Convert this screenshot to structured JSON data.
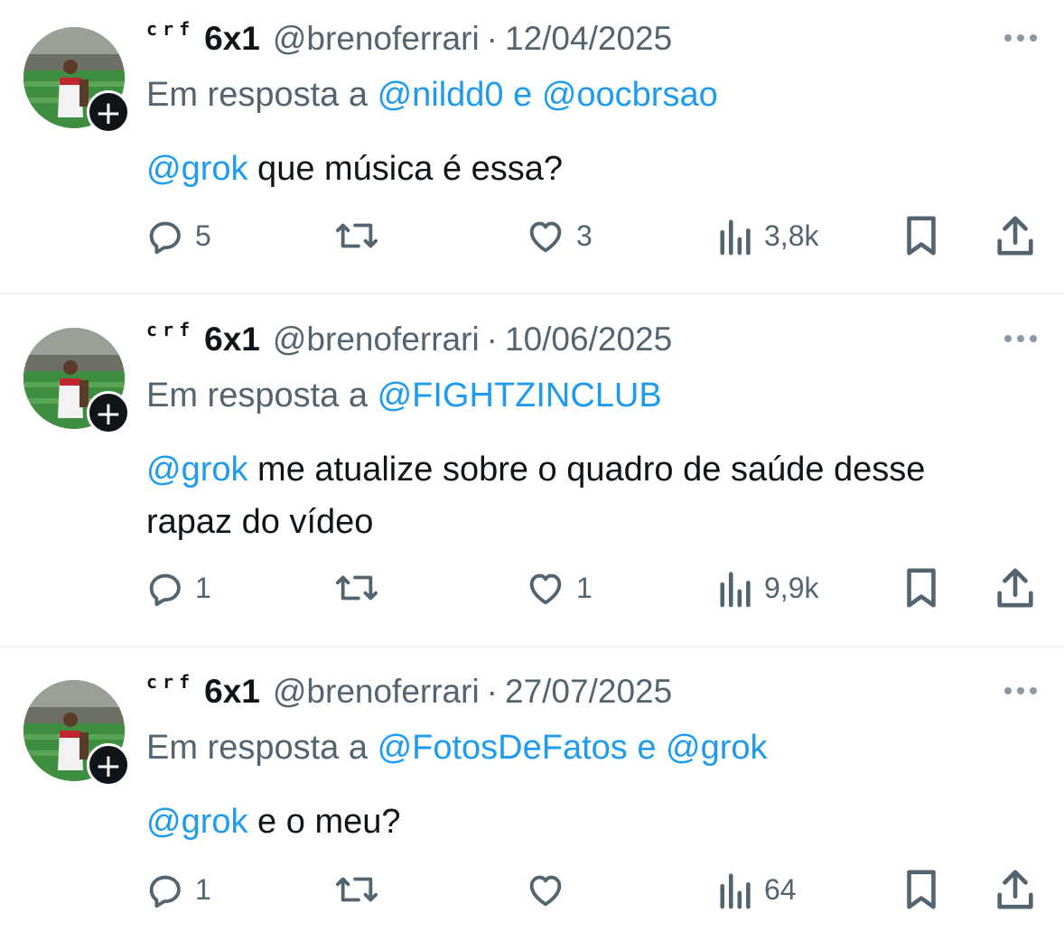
{
  "tweets": [
    {
      "author": {
        "prefix": "crf",
        "name": "6x1",
        "handle": "@breno​ferrari"
      },
      "date": "12/04/2025",
      "reply_label": "Em resposta a ",
      "reply_mentions": [
        "@nildd0",
        "@oocbrsao"
      ],
      "reply_joiner": " e ",
      "text_mention": "@grok",
      "text": " que música é essa?",
      "stats": {
        "replies": "5",
        "retweets": "",
        "likes": "3",
        "views": "3,8k"
      }
    },
    {
      "author": {
        "prefix": "crf",
        "name": "6x1",
        "handle": "@brenoferrari"
      },
      "date": "10/06/2025",
      "reply_label": "Em resposta a ",
      "reply_mentions": [
        "@FIGHTZINCLUB"
      ],
      "reply_joiner": "",
      "text_mention": "@grok",
      "text": " me atualize sobre o quadro de saúde desse rapaz do vídeo",
      "stats": {
        "replies": "1",
        "retweets": "",
        "likes": "1",
        "views": "9,9k"
      }
    },
    {
      "author": {
        "prefix": "crf",
        "name": "6x1",
        "handle": "@brenoferrari"
      },
      "date": "27/07/2025",
      "reply_label": "Em resposta a ",
      "reply_mentions": [
        "@FotosDeFatos",
        "@grok"
      ],
      "reply_joiner": " e ",
      "text_mention": "@grok",
      "text": " e o meu?",
      "stats": {
        "replies": "1",
        "retweets": "",
        "likes": "",
        "views": "64"
      }
    }
  ],
  "icons": {
    "reply": "speech-bubble-icon",
    "retweet": "retweet-icon",
    "like": "heart-icon",
    "views": "bar-chart-icon",
    "bookmark": "bookmark-icon",
    "share": "share-icon",
    "more": "more-horizontal-icon",
    "follow": "plus-icon"
  },
  "colors": {
    "link": "#1d9bf0",
    "muted": "#536471",
    "text": "#0f1419"
  }
}
